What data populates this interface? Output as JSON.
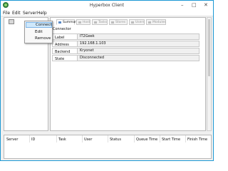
{
  "window": {
    "title": "Hyperbox Client",
    "controls": {
      "minimize": "–",
      "maximize": "□",
      "close": "✕"
    }
  },
  "menu": [
    "File",
    "Edit",
    "Server",
    "Help"
  ],
  "context_menu": {
    "items": [
      "Connect",
      "Edit",
      "Remove"
    ],
    "highlighted": "Connect"
  },
  "tabs": [
    "Summary",
    "Host",
    "Tasks",
    "Stores",
    "Users",
    "Modules"
  ],
  "active_tab": "Summary",
  "summary": {
    "group_label": "Connector",
    "fields": [
      {
        "label": "Label",
        "value": "IT2Geek"
      },
      {
        "label": "Address",
        "value": "192.168.1.103"
      },
      {
        "label": "Backend",
        "value": "Kryonet"
      },
      {
        "label": "State",
        "value": "Disconnected"
      }
    ]
  },
  "task_queue": {
    "columns": [
      "Server",
      "ID",
      "Task",
      "User",
      "Status",
      "Queue Time",
      "Start Time",
      "Finish Time"
    ]
  },
  "colors": {
    "window_border": "#1c98d4",
    "menu_highlight": "#cfe8fb"
  }
}
